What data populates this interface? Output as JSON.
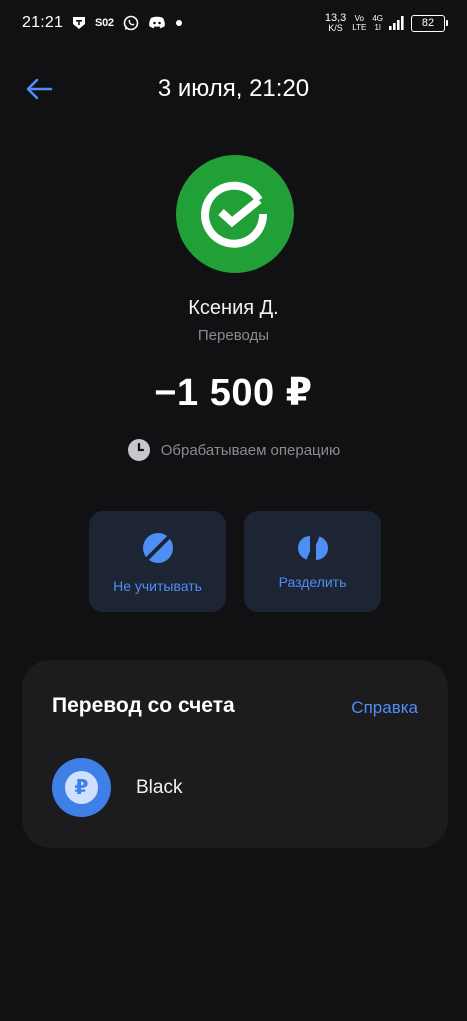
{
  "status_bar": {
    "time": "21:21",
    "carrier_tag": "S02",
    "net_speed_value": "13,3",
    "net_speed_unit": "K/S",
    "volte_top": "Vo",
    "volte_bottom": "LTE",
    "network_top": "4G",
    "network_bottom": "1l",
    "battery": "82"
  },
  "header": {
    "title": "3 июля, 21:20"
  },
  "transaction": {
    "merchant_name": "Ксения Д.",
    "category": "Переводы",
    "amount": "−1 500 ₽",
    "status": "Обрабатываем операцию"
  },
  "actions": [
    {
      "label": "Не учитывать",
      "icon": "eye-off-icon"
    },
    {
      "label": "Разделить",
      "icon": "split-icon"
    }
  ],
  "account_card": {
    "title": "Перевод со счета",
    "help_label": "Справка",
    "account_name": "Black",
    "account_icon_glyph": "₽"
  },
  "colors": {
    "background": "#111113",
    "accent": "#4f8ef7",
    "brand_green": "#21a038",
    "card": "#1c1c1f",
    "action_bg": "#1d2433"
  }
}
